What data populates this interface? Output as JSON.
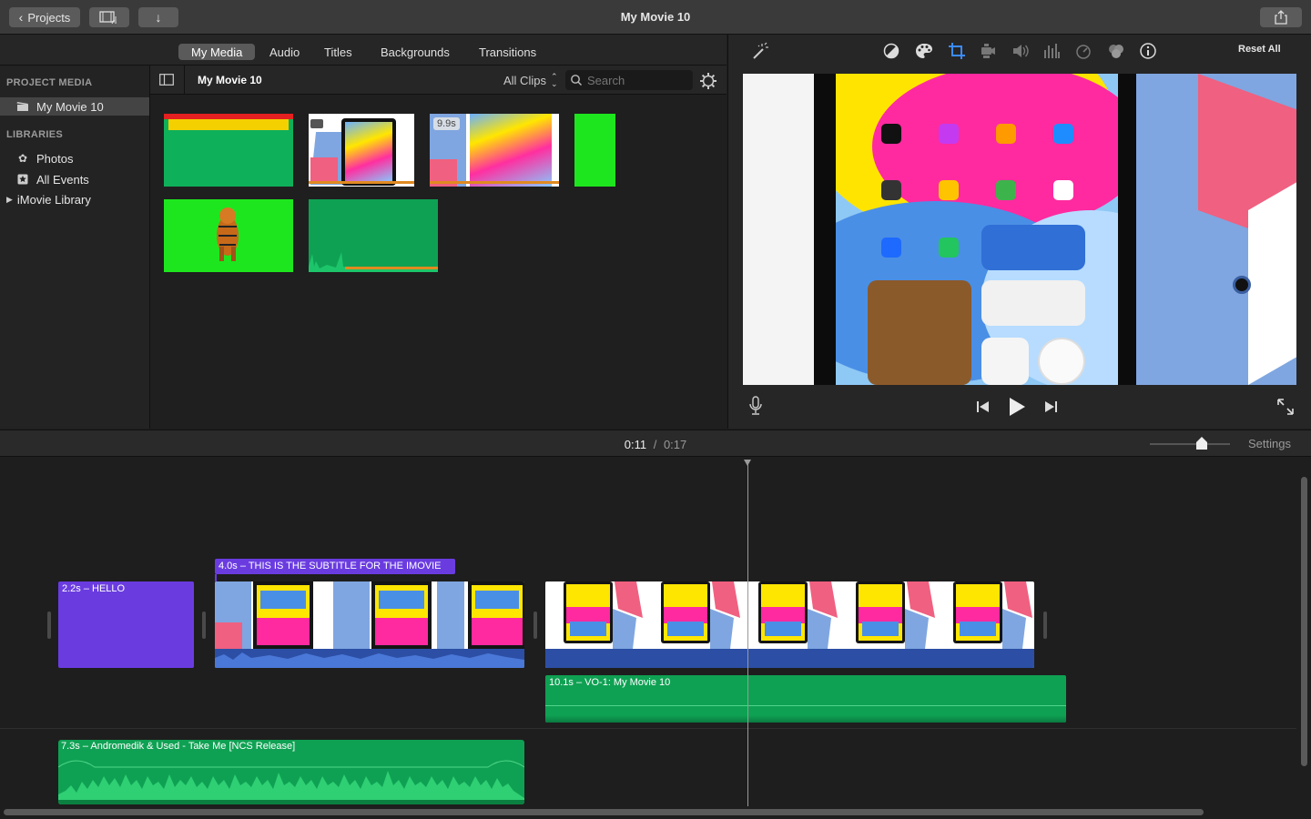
{
  "window": {
    "title": "My Movie 10",
    "projects_label": "Projects"
  },
  "browser_tabs": [
    {
      "label": "My Media",
      "active": true
    },
    {
      "label": "Audio",
      "active": false
    },
    {
      "label": "Titles",
      "active": false
    },
    {
      "label": "Backgrounds",
      "active": false
    },
    {
      "label": "Transitions",
      "active": false
    }
  ],
  "sidebar": {
    "project_media_header": "PROJECT MEDIA",
    "project_item": "My Movie 10",
    "libraries_header": "LIBRARIES",
    "items": [
      {
        "label": "Photos",
        "icon": "photos-icon"
      },
      {
        "label": "All Events",
        "icon": "star-icon"
      },
      {
        "label": "iMovie Library",
        "icon": "disclosure-triangle-icon"
      }
    ]
  },
  "media": {
    "title": "My Movie 10",
    "filter_label": "All Clips",
    "search_placeholder": "Search",
    "clip_duration_badge": "9.9s"
  },
  "viewer": {
    "reset_all_label": "Reset All",
    "adjust_icons": [
      "magic-wand-icon",
      "color-balance-icon",
      "color-correction-icon",
      "crop-icon",
      "stabilization-icon",
      "volume-icon",
      "noise-reduction-icon",
      "speed-icon",
      "clip-filter-icon",
      "info-icon"
    ]
  },
  "timeline": {
    "current_time": "0:11",
    "separator": "/",
    "total_time": "0:17",
    "settings_label": "Settings",
    "zoom_level": 0.65,
    "clips": {
      "title_clip": "2.2s – HELLO",
      "subtitle_clip": "4.0s – THIS IS THE SUBTITLE FOR THE IMOVIE",
      "voiceover_clip": "10.1s – VO-1: My Movie 10",
      "music_clip": "7.3s – Andromedik & Used - Take Me [NCS Release]"
    }
  },
  "colors": {
    "title_purple": "#6a3ce0",
    "audio_green": "#0fa153",
    "clip_audio_blue": "#2c4fa5",
    "green_screen": "#1ee61e"
  }
}
